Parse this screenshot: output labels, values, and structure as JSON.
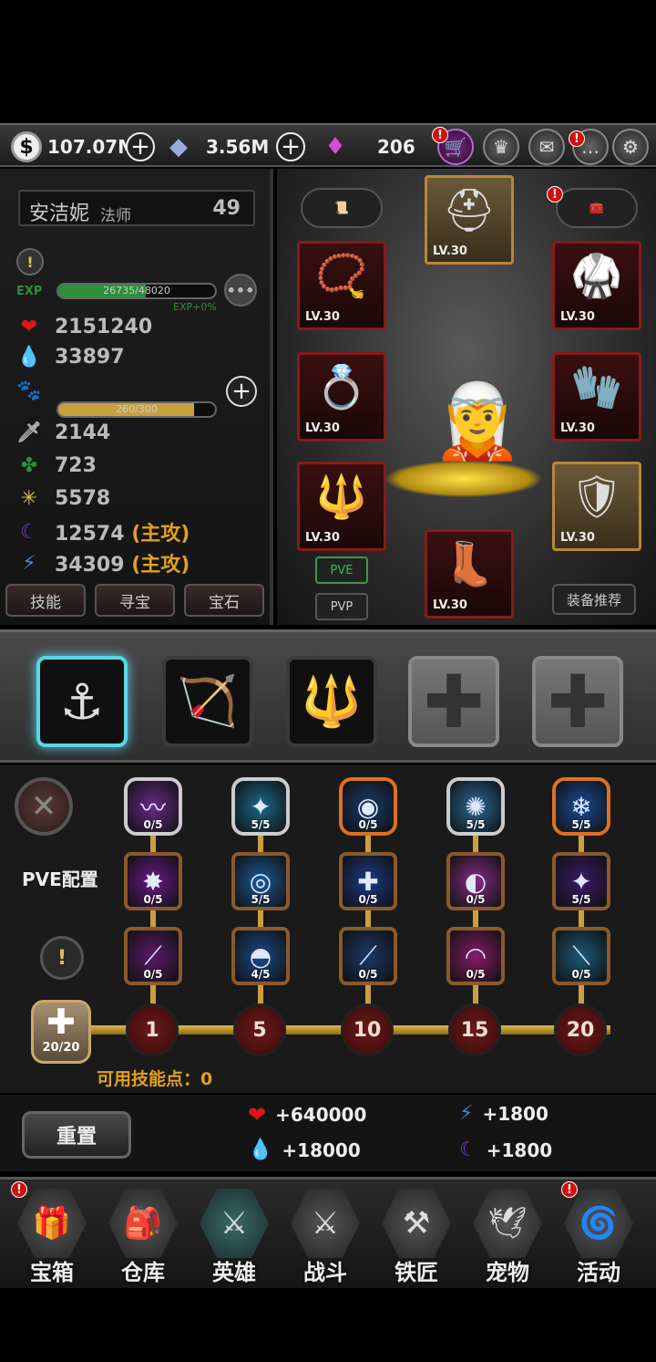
{
  "currency": {
    "coins": "107.07M",
    "crystals": "3.56M",
    "gems": "206"
  },
  "hero": {
    "name": "安洁妮",
    "class": "法师",
    "level": "49",
    "exp_label": "EXP",
    "exp_text": "26735/48020",
    "exp_fraction": 0.557,
    "exp_bonus": "EXP+0%",
    "hp": "2151240",
    "mp": "33897",
    "pet_text": "260/300",
    "pet_fraction": 0.867,
    "attack": "2144",
    "defense": "723",
    "crit": "5578",
    "dark": "12574 (主攻)",
    "lightning": "34309 (主攻)"
  },
  "left_tabs": [
    "技能",
    "寻宝",
    "宝石"
  ],
  "equipment": {
    "level_label": "LV.30",
    "pve_label": "PVE",
    "pvp_label": "PVP",
    "recommend_label": "装备推荐"
  },
  "skill_tree": {
    "config_label": "PVE配置",
    "row1": [
      "0/5",
      "5/5",
      "0/5",
      "5/5",
      "5/5"
    ],
    "row2": [
      "0/5",
      "5/5",
      "0/5",
      "0/5",
      "5/5"
    ],
    "row3": [
      "0/5",
      "4/5",
      "0/5",
      "0/5",
      "0/5"
    ],
    "levels": [
      "1",
      "5",
      "10",
      "15",
      "20"
    ],
    "points_counter": "20/20",
    "available_points": "可用技能点：0"
  },
  "bonus": {
    "reset_label": "重置",
    "hp": "+640000",
    "lightning": "+1800",
    "mp": "+18000",
    "dark": "+1800"
  },
  "nav": [
    "宝箱",
    "仓库",
    "英雄",
    "战斗",
    "铁匠",
    "宠物",
    "活动"
  ],
  "colors": {
    "hp": "#d91818",
    "mp": "#1a6ee8",
    "exp": "#2e8f3a",
    "pet": "#c9a040",
    "gold_text": "#e0a020",
    "active": "#5ad6e8"
  }
}
